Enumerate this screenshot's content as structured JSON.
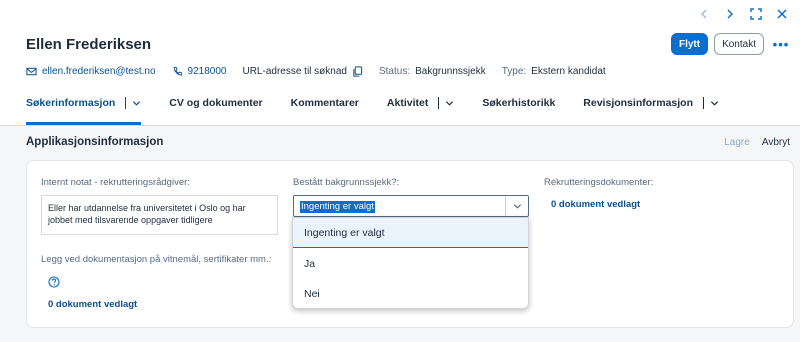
{
  "candidate": {
    "name": "Ellen Frederiksen",
    "email": "ellen.frederiksen@test.no",
    "phone": "9218000",
    "url_label": "URL-adresse til søknad",
    "status_label": "Status:",
    "status_value": "Bakgrunnssjekk",
    "type_label": "Type:",
    "type_value": "Ekstern kandidat"
  },
  "actions": {
    "move": "Flytt",
    "contact": "Kontakt",
    "more": "•••"
  },
  "tabs": [
    {
      "label": "Søkerinformasjon",
      "has_menu": true,
      "active": true
    },
    {
      "label": "CV og dokumenter",
      "has_menu": false,
      "active": false
    },
    {
      "label": "Kommentarer",
      "has_menu": false,
      "active": false
    },
    {
      "label": "Aktivitet",
      "has_menu": true,
      "active": false
    },
    {
      "label": "Søkerhistorikk",
      "has_menu": false,
      "active": false
    },
    {
      "label": "Revisjonsinformasjon",
      "has_menu": true,
      "active": false
    }
  ],
  "section": {
    "title": "Applikasjonsinformasjon",
    "save": "Lagre",
    "cancel": "Avbryt"
  },
  "fields": {
    "internal_note_label": "Internt notat - rekrutteringsrådgiver:",
    "internal_note_value": "Eller har utdannelse fra universitetet i Oslo og har jobbet med tilsvarende oppgaver tidligere",
    "attach_label": "Legg ved dokumentasjon på vitnemål, sertifikater mm.:",
    "attach_docs": "0 dokument vedlagt",
    "bg_check_label": "Bestått bakgrunnssjekk?:",
    "bg_check_value": "Ingenting er valgt",
    "bg_check_options": [
      "Ingenting er valgt",
      "Ja",
      "Nei"
    ],
    "recruit_docs_label": "Rekrutteringsdokumenter:",
    "recruit_docs": "0 dokument vedlagt"
  },
  "colors": {
    "accent": "#0a6ed1",
    "link": "#0a4f8f",
    "text": "#1d2d3e"
  }
}
